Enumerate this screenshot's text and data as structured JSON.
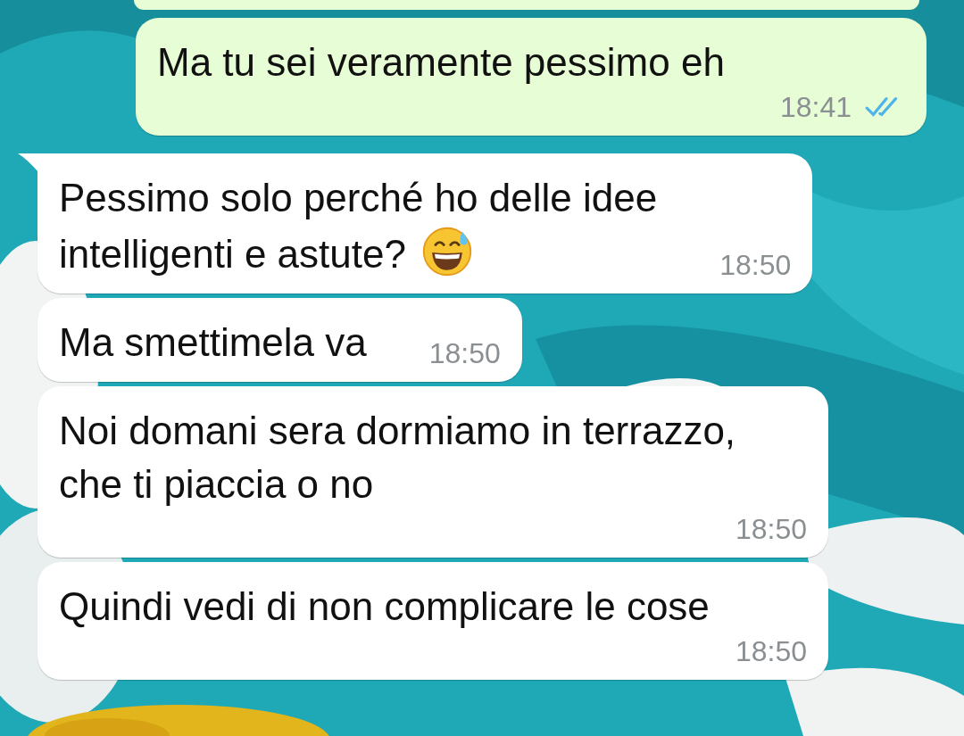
{
  "messages": [
    {
      "kind": "outgoing",
      "tail": false,
      "text": "Ma tu sei veramente pessimo eh",
      "time": "18:41",
      "read": true
    },
    {
      "kind": "incoming",
      "tail": true,
      "text": "Pessimo solo perché ho delle idee\nintelligenti e astute?",
      "emoji": true,
      "time": "18:50"
    },
    {
      "kind": "incoming",
      "tail": false,
      "text": "Ma smettimela va",
      "time": "18:50"
    },
    {
      "kind": "incoming",
      "tail": false,
      "text": "Noi domani sera dormiamo in terrazzo,\nche ti piaccia o no",
      "time": "18:50"
    },
    {
      "kind": "incoming",
      "tail": false,
      "text": "Quindi vedi di non complicare le cose",
      "time": "18:50"
    }
  ]
}
